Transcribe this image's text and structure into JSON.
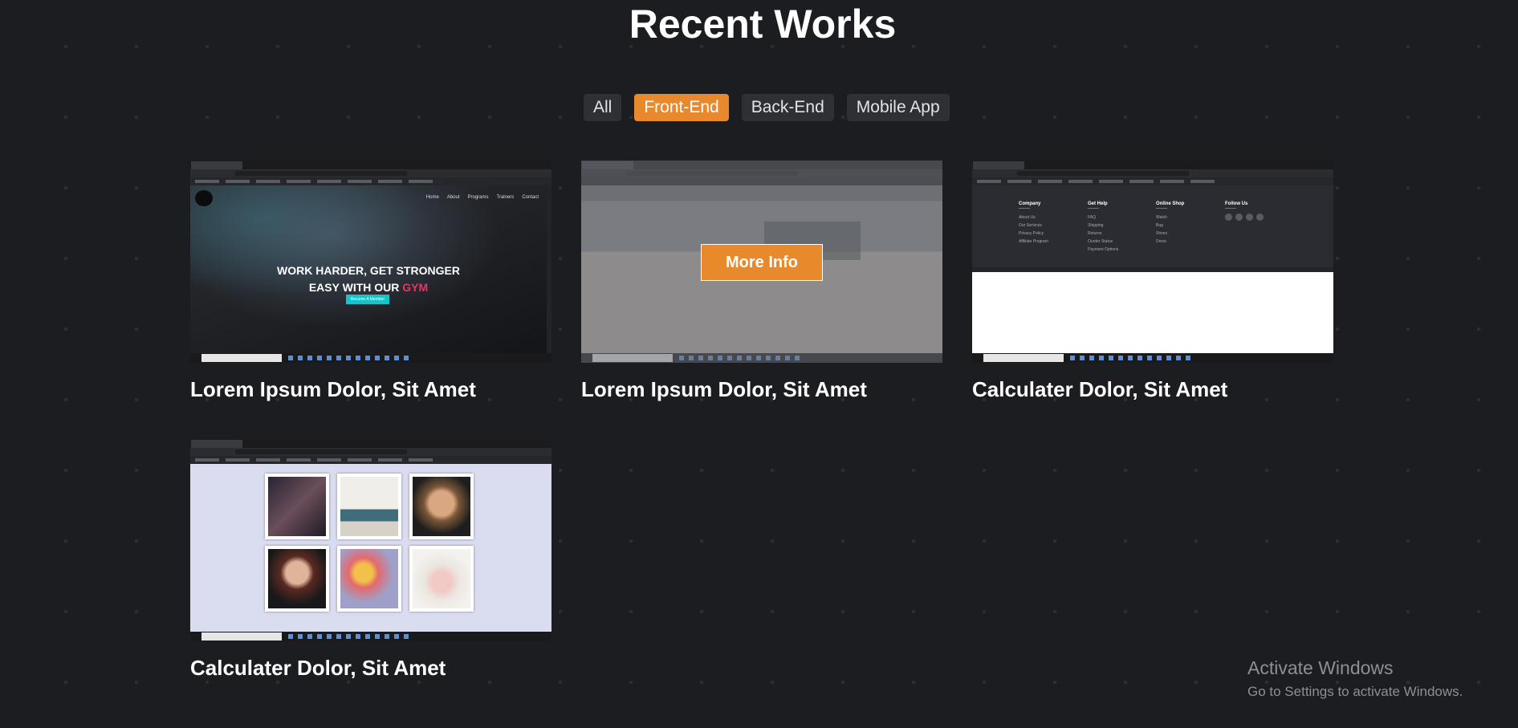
{
  "section": {
    "title": "Recent Works"
  },
  "filters": [
    {
      "label": "All",
      "active": false
    },
    {
      "label": "Front-End",
      "active": true
    },
    {
      "label": "Back-End",
      "active": false
    },
    {
      "label": "Mobile App",
      "active": false
    }
  ],
  "works": [
    {
      "title": "Lorem Ipsum Dolor, Sit Amet",
      "nav": [
        "Home",
        "About",
        "Programs",
        "Trainers",
        "Contact"
      ],
      "headline_1": "WORK HARDER, GET STRONGER",
      "headline_2_prefix": "EASY WITH OUR ",
      "headline_2_accent": "GYM",
      "button": "Become A Member"
    },
    {
      "title": "Lorem Ipsum Dolor, Sit Amet",
      "overlay_button": "More Info"
    },
    {
      "title": "Calculater Dolor, Sit Amet",
      "columns": [
        {
          "heading": "Company",
          "links": [
            "About Us",
            "Our Services",
            "Privacy Policy",
            "Affiliate Program"
          ]
        },
        {
          "heading": "Get Help",
          "links": [
            "FAQ",
            "Shipping",
            "Returns",
            "Ourder Status",
            "Payment Options"
          ]
        },
        {
          "heading": "Online Shop",
          "links": [
            "Watch",
            "Bag",
            "Shoes",
            "Dress"
          ]
        },
        {
          "heading": "Follow Us",
          "links": []
        }
      ]
    },
    {
      "title": "Calculater Dolor, Sit Amet"
    }
  ],
  "watermark": {
    "line1": "Activate Windows",
    "line2": "Go to Settings to activate Windows."
  },
  "colors": {
    "accent": "#e8892d",
    "background": "#1c1d21"
  }
}
